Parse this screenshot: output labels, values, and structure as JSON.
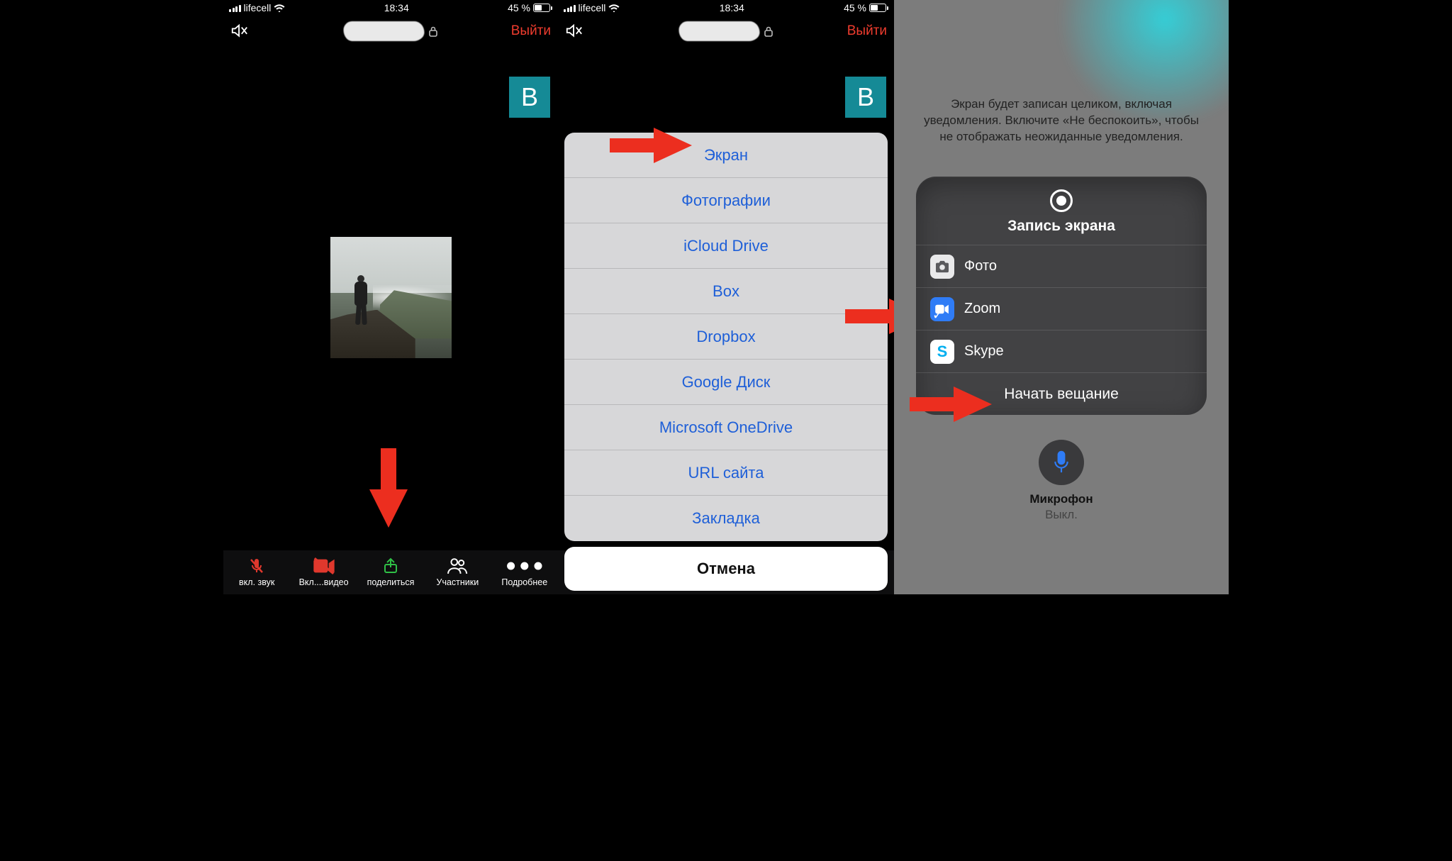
{
  "status": {
    "carrier": "lifecell",
    "time": "18:34",
    "battery_text": "45 %"
  },
  "nav": {
    "exit": "Выйти"
  },
  "tile": {
    "letter": "В"
  },
  "toolbar": {
    "audio": "вкл. звук",
    "video": "Вкл....видео",
    "share": "поделиться",
    "participants": "Участники",
    "more": "Подробнее"
  },
  "sheet": {
    "items": [
      "Экран",
      "Фотографии",
      "iCloud Drive",
      "Box",
      "Dropbox",
      "Google Диск",
      "Microsoft OneDrive",
      "URL сайта",
      "Закладка"
    ],
    "cancel": "Отмена"
  },
  "right": {
    "message": "Экран будет записан целиком, включая уведомления. Включите «Не беспокоить», чтобы не отображать неожиданные уведомления.",
    "title": "Запись экрана",
    "apps": {
      "photo": "Фото",
      "zoom": "Zoom",
      "skype": "Skype"
    },
    "start": "Начать вещание",
    "mic_label": "Микрофон",
    "mic_state": "Выкл."
  }
}
